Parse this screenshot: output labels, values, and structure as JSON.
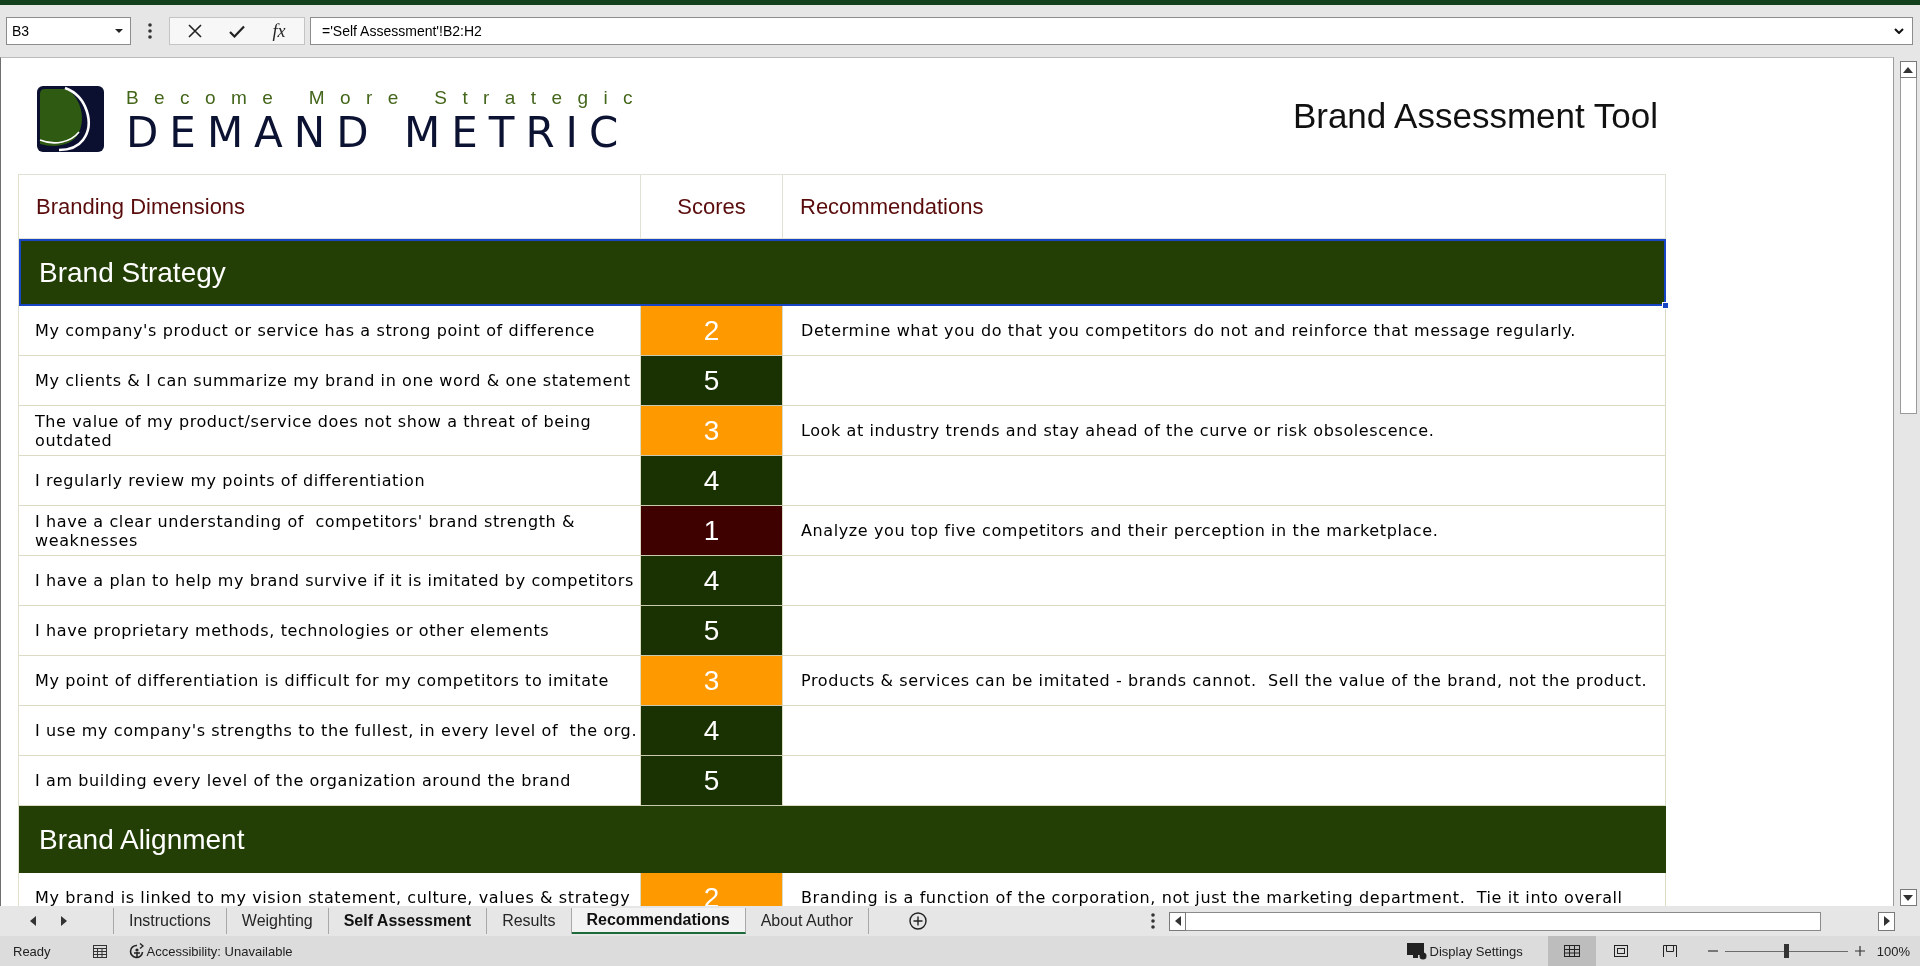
{
  "formula_bar": {
    "name_box": "B3",
    "function_label": "fx",
    "formula": "='Self Assessment'!B2:H2"
  },
  "sheet": {
    "tagline": "Become More Strategic",
    "brand": "DEMAND METRIC",
    "title": "Brand Assessment Tool",
    "table": {
      "columns": [
        "Branding Dimensions",
        "Scores",
        "Recommendations"
      ],
      "sections": [
        {
          "title": "Brand Strategy",
          "selected": true,
          "rows": [
            {
              "dimension": "My company's product or service has a strong point of difference",
              "score": "2",
              "color": "#ff9900",
              "recommendation": "Determine what you do that you competitors do not and reinforce that message regularly."
            },
            {
              "dimension": "My clients & I can summarize my brand in one word & one statement",
              "score": "5",
              "color": "#1a3202"
            },
            {
              "dimension": "The value of my product/service does not show a threat of being outdated",
              "score": "3",
              "color": "#ff9900",
              "recommendation": "Look at industry trends and stay ahead of the curve or risk obsolescence."
            },
            {
              "dimension": "I regularly review my points of differentiation",
              "score": "4",
              "color": "#1a3202"
            },
            {
              "dimension": "I have a clear understanding of  competitors' brand strength & weaknesses",
              "score": "1",
              "color": "#3f0000",
              "recommendation": "Analyze you top five competitors and their perception in the marketplace."
            },
            {
              "dimension": "I have a plan to help my brand survive if it is imitated by competitors",
              "score": "4",
              "color": "#1a3202"
            },
            {
              "dimension": "I have proprietary methods, technologies or other elements",
              "score": "5",
              "color": "#1a3202"
            },
            {
              "dimension": "My point of differentiation is difficult for my competitors to imitate",
              "score": "3",
              "color": "#ff9900",
              "recommendation": "Products & services can be imitated - brands cannot.  Sell the value of the brand, not the product."
            },
            {
              "dimension": "I use my company's strengths to the fullest, in every level of  the org.",
              "score": "4",
              "color": "#1a3202"
            },
            {
              "dimension": "I am building every level of the organization around the brand",
              "score": "5",
              "color": "#1a3202"
            }
          ]
        },
        {
          "title": "Brand Alignment",
          "selected": false,
          "rows": [
            {
              "dimension": "My brand is linked to my vision statement, culture, values & strategy",
              "score": "2",
              "color": "#ff9900",
              "recommendation": "Branding is a function of the corporation, not just the marketing department.  Tie it into overall"
            }
          ]
        }
      ]
    }
  },
  "sheet_tabs": [
    {
      "label": "Instructions",
      "selected": false,
      "emphasized": false
    },
    {
      "label": "Weighting",
      "selected": false,
      "emphasized": false
    },
    {
      "label": "Self Assessment",
      "selected": false,
      "emphasized": true
    },
    {
      "label": "Results",
      "selected": false,
      "emphasized": false
    },
    {
      "label": "Recommendations",
      "selected": true,
      "emphasized": true
    },
    {
      "label": "About Author",
      "selected": false,
      "emphasized": false
    }
  ],
  "status_bar": {
    "mode": "Ready",
    "accessibility": "Accessibility: Unavailable",
    "display_settings": "Display Settings",
    "views": [
      {
        "kind": "normal",
        "selected": true
      },
      {
        "kind": "page_layout",
        "selected": false
      },
      {
        "kind": "page_break_preview",
        "selected": false
      }
    ],
    "zoom": {
      "level": 0.5,
      "reading": "100%"
    }
  }
}
